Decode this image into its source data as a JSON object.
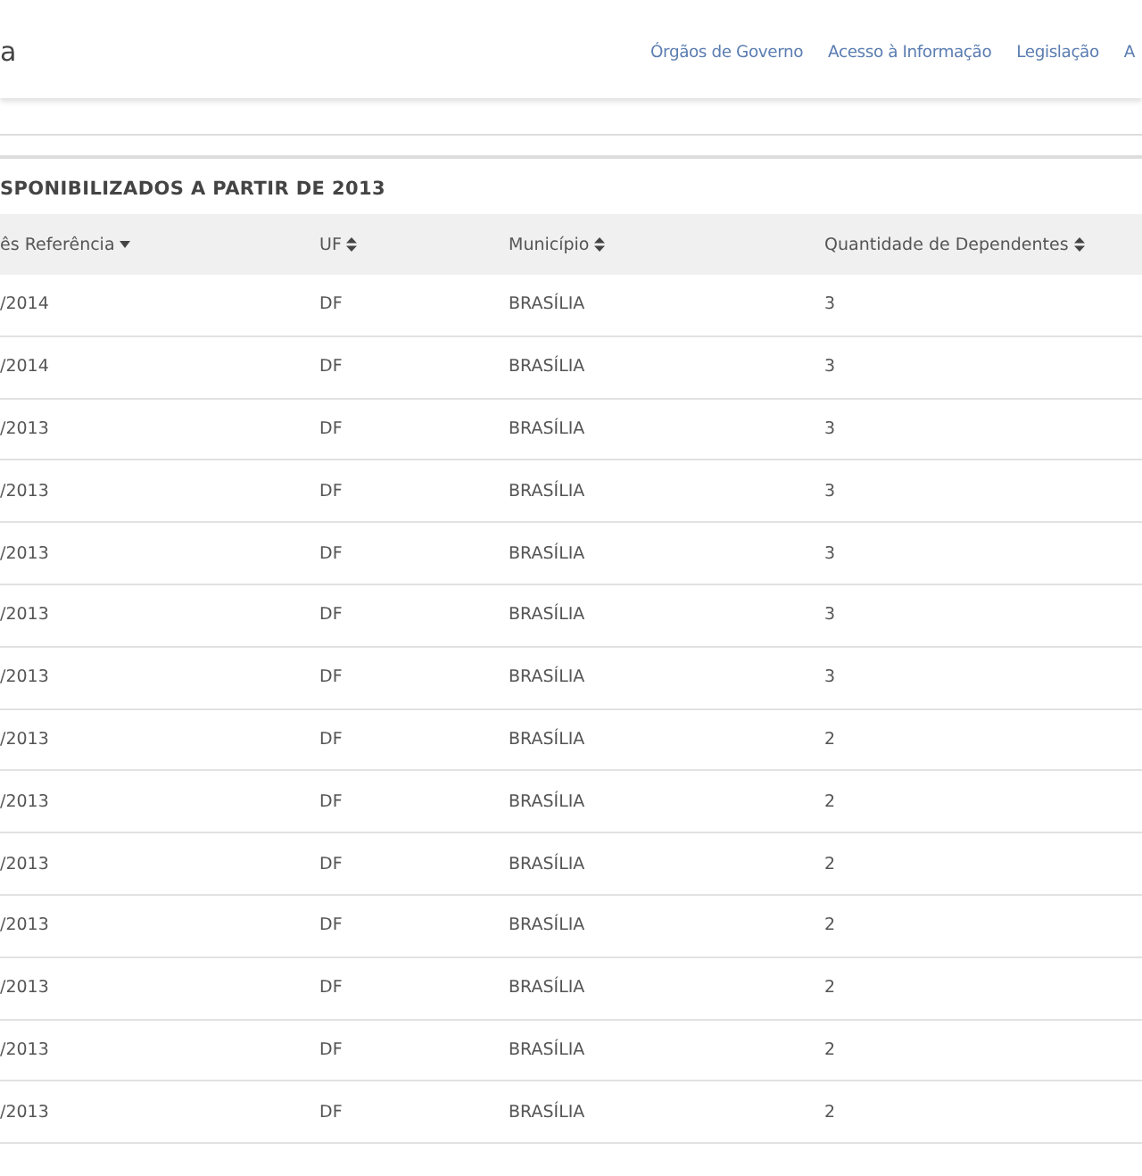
{
  "header": {
    "logo_text": "a",
    "nav": [
      "Órgãos de Governo",
      "Acesso à Informação",
      "Legislação",
      "A"
    ]
  },
  "section": {
    "title": "SPONIBILIZADOS A PARTIR DE 2013"
  },
  "table": {
    "columns": [
      {
        "label": "ês Referência",
        "sorted": true
      },
      {
        "label": "UF",
        "sorted": false
      },
      {
        "label": "Município",
        "sorted": false
      },
      {
        "label": "Quantidade de Dependentes",
        "sorted": false
      }
    ],
    "rows": [
      [
        "/2014",
        "DF",
        "BRASÍLIA",
        "3"
      ],
      [
        "/2014",
        "DF",
        "BRASÍLIA",
        "3"
      ],
      [
        "/2013",
        "DF",
        "BRASÍLIA",
        "3"
      ],
      [
        "/2013",
        "DF",
        "BRASÍLIA",
        "3"
      ],
      [
        "/2013",
        "DF",
        "BRASÍLIA",
        "3"
      ],
      [
        "/2013",
        "DF",
        "BRASÍLIA",
        "3"
      ],
      [
        "/2013",
        "DF",
        "BRASÍLIA",
        "3"
      ],
      [
        "/2013",
        "DF",
        "BRASÍLIA",
        "2"
      ],
      [
        "/2013",
        "DF",
        "BRASÍLIA",
        "2"
      ],
      [
        "/2013",
        "DF",
        "BRASÍLIA",
        "2"
      ],
      [
        "/2013",
        "DF",
        "BRASÍLIA",
        "2"
      ],
      [
        "/2013",
        "DF",
        "BRASÍLIA",
        "2"
      ],
      [
        "/2013",
        "DF",
        "BRASÍLIA",
        "2"
      ],
      [
        "/2013",
        "DF",
        "BRASÍLIA",
        "2"
      ]
    ]
  }
}
